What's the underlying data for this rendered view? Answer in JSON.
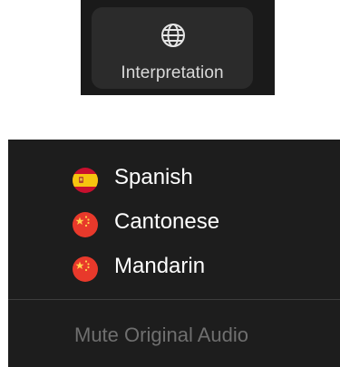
{
  "toolbar": {
    "interpretation_label": "Interpretation",
    "icon": "globe-icon"
  },
  "menu": {
    "languages": [
      {
        "label": "Spanish",
        "flag": "spain-flag-icon"
      },
      {
        "label": "Cantonese",
        "flag": "china-flag-icon"
      },
      {
        "label": "Mandarin",
        "flag": "china-flag-icon"
      }
    ],
    "mute_label": "Mute Original Audio",
    "mute_state": "disabled"
  },
  "colors": {
    "toolbar_bg": "#1a1a1a",
    "button_bg": "#2b2b2b",
    "menu_bg": "#1d1d1d",
    "text": "#ffffff",
    "disabled_text": "#6f6f6f",
    "china_red": "#e8392b",
    "spain_yellow": "#f6c40f"
  }
}
